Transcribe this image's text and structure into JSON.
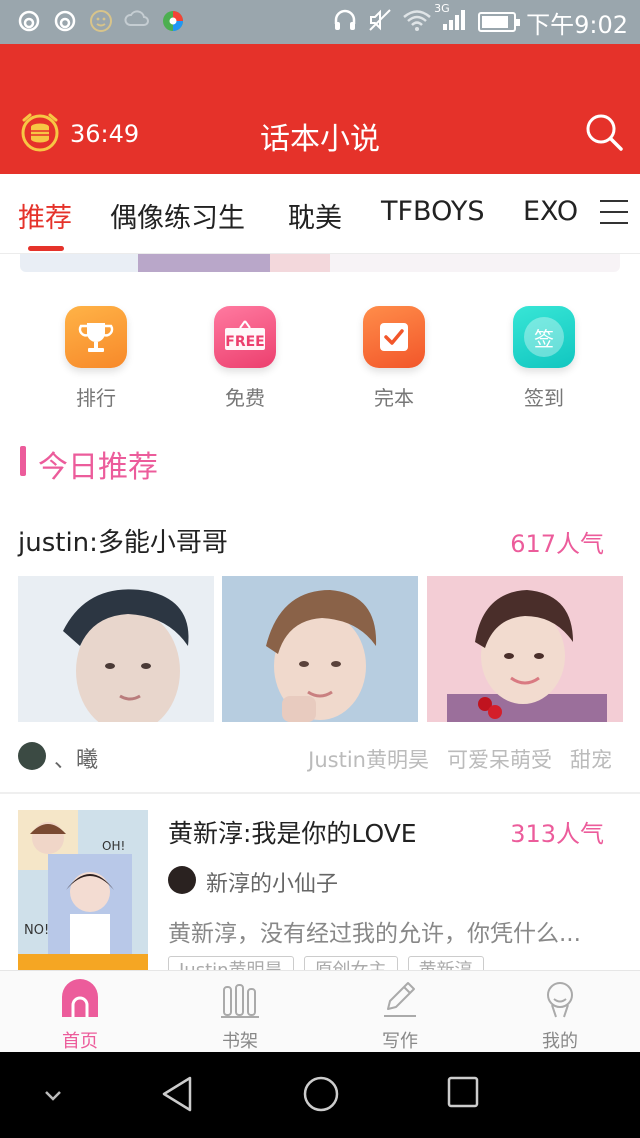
{
  "status_bar": {
    "time": "下午9:02",
    "network": "3G",
    "battery_level": 0.85
  },
  "header": {
    "title": "话本小说",
    "timer": "36:49"
  },
  "tabs": [
    {
      "label": "推荐",
      "active": true
    },
    {
      "label": "偶像练习生",
      "active": false
    },
    {
      "label": "耽美",
      "active": false
    },
    {
      "label": "TFBOYS",
      "active": false
    },
    {
      "label": "EXO",
      "active": false
    }
  ],
  "quick_entries": [
    {
      "label": "排行",
      "icon": "trophy-icon"
    },
    {
      "label": "免费",
      "icon": "free-icon",
      "badge": "FREE"
    },
    {
      "label": "完本",
      "icon": "completed-icon"
    },
    {
      "label": "签到",
      "icon": "checkin-icon",
      "badge": "签"
    }
  ],
  "section": {
    "title": "今日推荐"
  },
  "books": [
    {
      "title": "justin:多能小哥哥",
      "popularity": "617人气",
      "author": "、曦",
      "tags": [
        "Justin黄明昊",
        "可爱呆萌受",
        "甜宠"
      ]
    },
    {
      "title": "黄新淳:我是你的LOVE",
      "popularity": "313人气",
      "author": "新淳的小仙子",
      "description": "黄新淳，没有经过我的允许，你凭什么...",
      "tags": [
        "Justin黄明昊",
        "原创女主",
        "黄新淳"
      ]
    }
  ],
  "bottom_nav": [
    {
      "label": "首页",
      "icon": "home-icon",
      "active": true
    },
    {
      "label": "书架",
      "icon": "bookshelf-icon",
      "active": false
    },
    {
      "label": "写作",
      "icon": "pencil-icon",
      "active": false
    },
    {
      "label": "我的",
      "icon": "profile-icon",
      "active": false
    }
  ],
  "colors": {
    "brand_red": "#e5322a",
    "accent_pink": "#ec5c9b"
  }
}
